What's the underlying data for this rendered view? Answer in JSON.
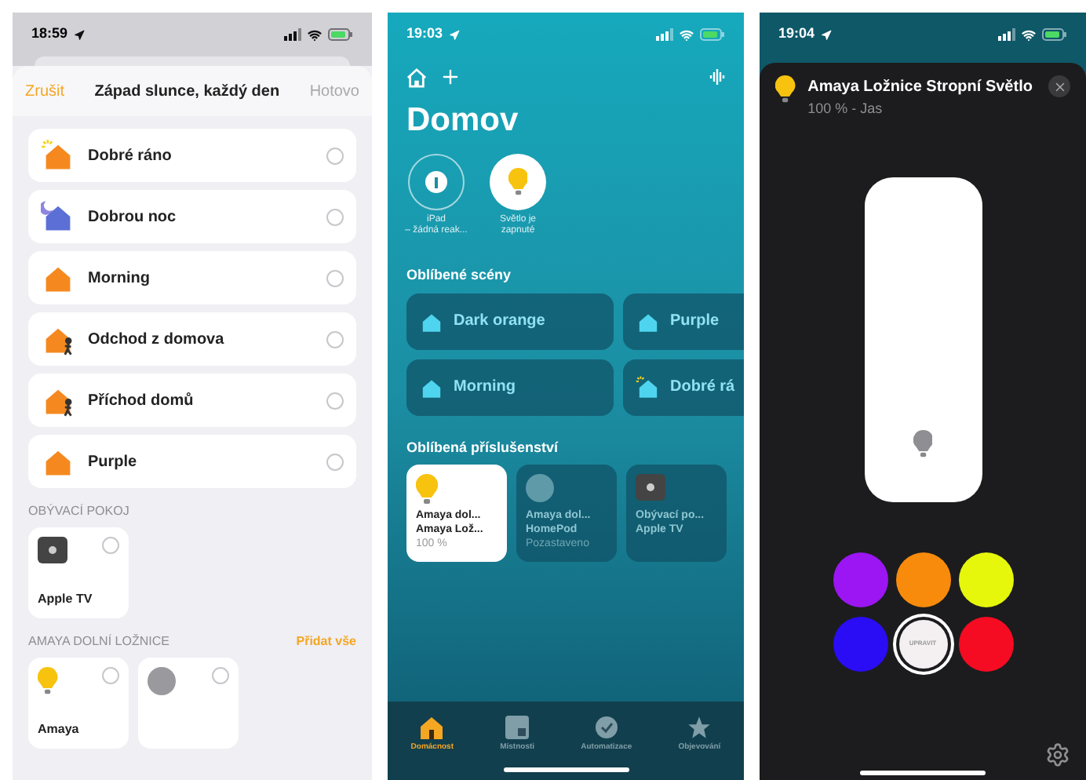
{
  "scene_picker": {
    "status_time": "18:59",
    "cancel": "Zrušit",
    "title": "Západ slunce, každý den",
    "done": {
      "label": "Hotovo",
      "disabled": true
    },
    "scenes": [
      {
        "name": "Dobré ráno",
        "kind": "sunrise",
        "color": "#f5891f",
        "selected": false
      },
      {
        "name": "Dobrou noc",
        "kind": "night",
        "color": "#5b6fd6",
        "selected": false
      },
      {
        "name": "Morning",
        "kind": "house",
        "color": "#f5891f",
        "selected": false
      },
      {
        "name": "Odchod z domova",
        "kind": "leave",
        "color": "#f5891f",
        "selected": false
      },
      {
        "name": "Příchod domů",
        "kind": "arrive",
        "color": "#f5891f",
        "selected": false
      },
      {
        "name": "Purple",
        "kind": "house",
        "color": "#f5891f",
        "selected": false
      }
    ],
    "rooms": [
      {
        "title": "OBÝVACÍ POKOJ",
        "devices": [
          {
            "kind": "tv",
            "name": "Apple TV",
            "selected": false
          }
        ]
      },
      {
        "title": "AMAYA DOLNÍ LOŽNICE",
        "add_all": "Přidat vše",
        "devices": [
          {
            "kind": "light",
            "name": "Amaya",
            "selected": false
          },
          {
            "kind": "speaker",
            "selected": false
          }
        ]
      }
    ]
  },
  "home": {
    "status_time": "19:03",
    "title": "Domov",
    "status_items": [
      {
        "kind": "alert",
        "label": "iPad\n– žádná reak..."
      },
      {
        "kind": "light",
        "label": "Světlo je\nzapnuté"
      }
    ],
    "scenes_title": "Oblíbené scény",
    "scenes": [
      {
        "name": "Dark orange",
        "kind": "house"
      },
      {
        "name": "Purple",
        "kind": "house"
      },
      {
        "name": "Morning",
        "kind": "house"
      },
      {
        "name": "Dobré rá",
        "kind": "sunrise"
      }
    ],
    "accessories_title": "Oblíbená příslušenství",
    "accessories": [
      {
        "kind": "light",
        "on": true,
        "lines": [
          "Amaya dol...",
          "Amaya Lož..."
        ],
        "status": "100 %"
      },
      {
        "kind": "speaker",
        "on": false,
        "lines": [
          "Amaya dol...",
          "HomePod"
        ],
        "status": "Pozastaveno"
      },
      {
        "kind": "tv",
        "on": false,
        "lines": [
          "Obývací po...",
          "Apple TV"
        ]
      }
    ],
    "tabs": [
      {
        "label": "Domácnost",
        "kind": "home",
        "selected": true
      },
      {
        "label": "Místnosti",
        "kind": "rooms",
        "selected": false
      },
      {
        "label": "Automatizace",
        "kind": "automation",
        "selected": false
      },
      {
        "label": "Objevování",
        "kind": "discover",
        "selected": false
      }
    ]
  },
  "light_control": {
    "status_time": "19:04",
    "title": "Amaya Ložnice Stropní Světlo",
    "subtitle": "100 % - Jas",
    "brightness": {
      "level": 1.0
    },
    "swatches": [
      {
        "kind": "color",
        "color": "#9b16f2",
        "selected": false
      },
      {
        "kind": "color",
        "color": "#f98b0c",
        "selected": false
      },
      {
        "kind": "color",
        "color": "#e6f70c",
        "selected": false
      },
      {
        "kind": "color",
        "color": "#2a0cf5",
        "selected": false
      },
      {
        "kind": "edit",
        "label": "UPRAVIT",
        "selected": true
      },
      {
        "kind": "color",
        "color": "#f50c22",
        "selected": false
      }
    ]
  }
}
